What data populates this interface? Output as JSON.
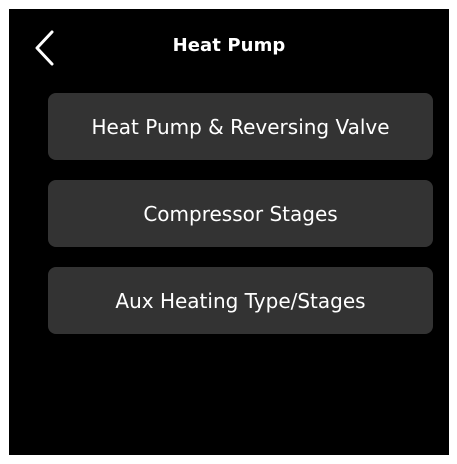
{
  "header": {
    "title": "Heat Pump",
    "back_icon": "chevron-left-icon"
  },
  "menu": {
    "items": [
      {
        "label": "Heat Pump & Reversing Valve"
      },
      {
        "label": "Compressor Stages"
      },
      {
        "label": "Aux Heating Type/Stages"
      }
    ]
  },
  "colors": {
    "background": "#000000",
    "button": "#333333",
    "text": "#ffffff"
  }
}
